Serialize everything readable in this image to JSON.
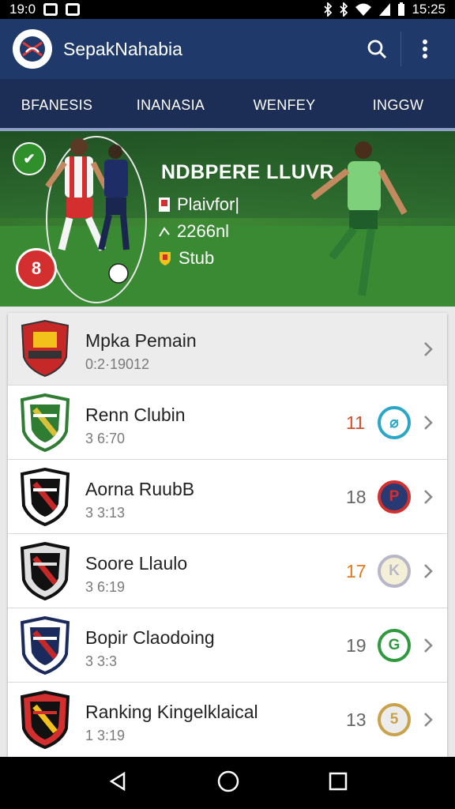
{
  "status_bar": {
    "time_left": "19:0",
    "time_right": "15:25"
  },
  "app": {
    "title": "SepakNahabia"
  },
  "tabs": [
    {
      "label": "BFANESIS"
    },
    {
      "label": "INANASIA"
    },
    {
      "label": "WENFEY"
    },
    {
      "label": "INGGW"
    }
  ],
  "banner": {
    "title": "NDBPERE LLUVR",
    "rows": [
      {
        "text": "Plaivfor|"
      },
      {
        "text": "2266nl"
      },
      {
        "text": "Stub"
      }
    ],
    "badge_top": "✔",
    "badge_bottom": "8"
  },
  "list": {
    "header": {
      "name": "Mpka Pemain",
      "sub": "0:2·19012"
    },
    "items": [
      {
        "name": "Renn Clubin",
        "sub": "3 6:70",
        "rank": "11",
        "rank_color": "#d94c2a",
        "circle_text": "⌀",
        "circle_color": "#2aa7c7",
        "circle_bg": "#ffffff",
        "crest": [
          "#2e7d32",
          "#ffffff",
          "#d9c23a"
        ]
      },
      {
        "name": "Aorna RuubB",
        "sub": "3 3:13",
        "rank": "18",
        "rank_color": "#666666",
        "circle_text": "P",
        "circle_color": "#d32f2f",
        "circle_bg": "#283a73",
        "crest": [
          "#111111",
          "#ffffff",
          "#c62828"
        ]
      },
      {
        "name": "Soore Llaulo",
        "sub": "3 6:19",
        "rank": "17",
        "rank_color": "#e07a1f",
        "circle_text": "K",
        "circle_color": "#b7b7c9",
        "circle_bg": "#f4f0d8",
        "crest": [
          "#111111",
          "#e0e0e0",
          "#c62828"
        ]
      },
      {
        "name": "Bopir Claodoing",
        "sub": "3 3:3",
        "rank": "19",
        "rank_color": "#666666",
        "circle_text": "G",
        "circle_color": "#2e9a3d",
        "circle_bg": "#ffffff",
        "crest": [
          "#1a2a5c",
          "#ffffff",
          "#c62828"
        ]
      },
      {
        "name": "Ranking Kingelklaical",
        "sub": "1 3:19",
        "rank": "13",
        "rank_color": "#666666",
        "circle_text": "5",
        "circle_color": "#c9a24a",
        "circle_bg": "#ececec",
        "crest": [
          "#111111",
          "#d32f2f",
          "#f2c21b"
        ]
      }
    ]
  }
}
